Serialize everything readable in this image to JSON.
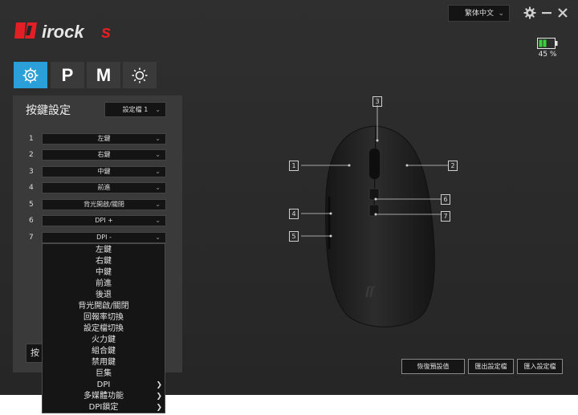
{
  "app": {
    "brand": "irocks",
    "language": "繁体中文",
    "battery": {
      "level_percent": 45,
      "label": "45 %",
      "color": "#3ad23a"
    }
  },
  "tabs": [
    {
      "label": "",
      "icon": "gear-icon",
      "active": true
    },
    {
      "label": "P",
      "active": false
    },
    {
      "label": "M",
      "active": false
    },
    {
      "label": "",
      "icon": "sun-icon",
      "active": false
    }
  ],
  "panel": {
    "title": "按鍵設定",
    "profile": "設定檔 1",
    "partial_label": "按鍵"
  },
  "key_rows": [
    {
      "num": "1",
      "value": "左鍵"
    },
    {
      "num": "2",
      "value": "右鍵"
    },
    {
      "num": "3",
      "value": "中鍵"
    },
    {
      "num": "4",
      "value": "前進"
    },
    {
      "num": "5",
      "value": "背光開啟/關閉"
    },
    {
      "num": "6",
      "value": "DPI +"
    },
    {
      "num": "7",
      "value": "DPI -"
    }
  ],
  "menu_items": [
    {
      "label": "左鍵",
      "submenu": false
    },
    {
      "label": "右鍵",
      "submenu": false
    },
    {
      "label": "中鍵",
      "submenu": false
    },
    {
      "label": "前進",
      "submenu": false
    },
    {
      "label": "後退",
      "submenu": false
    },
    {
      "label": "背光開啟/關閉",
      "submenu": false
    },
    {
      "label": "回報率切換",
      "submenu": false
    },
    {
      "label": "設定檔切換",
      "submenu": false
    },
    {
      "label": "火力鍵",
      "submenu": false
    },
    {
      "label": "組合鍵",
      "submenu": false
    },
    {
      "label": "禁用鍵",
      "submenu": false
    },
    {
      "label": "巨集",
      "submenu": false
    },
    {
      "label": "DPI",
      "submenu": true
    },
    {
      "label": "多媒體功能",
      "submenu": true
    },
    {
      "label": "DPI鎖定",
      "submenu": true
    }
  ],
  "buttons": {
    "restore_default": "恢復預設值",
    "export_profile": "匯出設定檔",
    "import_profile": "匯入設定檔"
  },
  "callouts": [
    "1",
    "2",
    "3",
    "4",
    "5",
    "6",
    "7"
  ]
}
